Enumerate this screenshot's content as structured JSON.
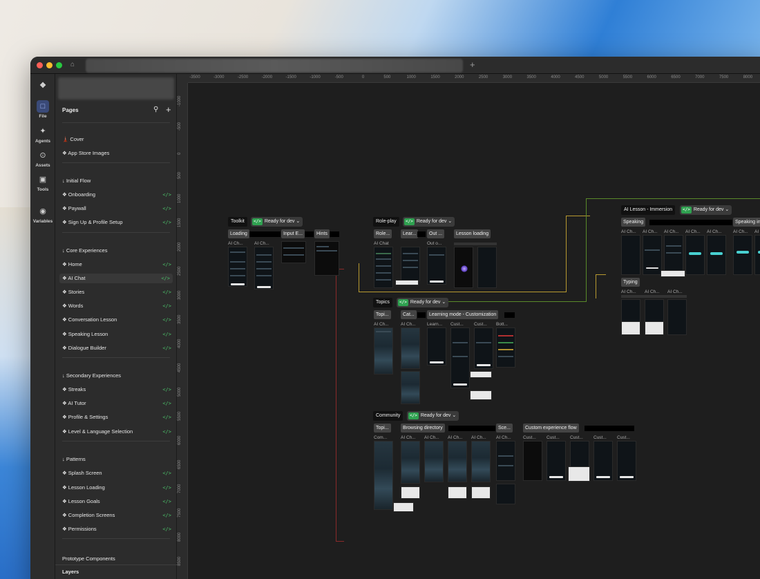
{
  "rail": [
    {
      "name": "file",
      "label": "File"
    },
    {
      "name": "agents",
      "label": "Agents"
    },
    {
      "name": "assets",
      "label": "Assets"
    },
    {
      "name": "tools",
      "label": "Tools"
    },
    {
      "name": "variables",
      "label": "Variables"
    }
  ],
  "pages": {
    "title": "Pages",
    "items": [
      {
        "label": "🗼 Cover",
        "dev": false
      },
      {
        "label": "❖ App Store Images",
        "dev": false
      },
      {
        "label": "↓ Initial Flow",
        "dev": false
      },
      {
        "label": "❖ Onboarding",
        "dev": true
      },
      {
        "label": "❖ Paywall",
        "dev": true
      },
      {
        "label": "❖ Sign Up & Profile Setup",
        "dev": true
      },
      {
        "label": "↓ Core Experiences",
        "dev": false
      },
      {
        "label": "❖ Home",
        "dev": true
      },
      {
        "label": "❖ AI Chat",
        "dev": true
      },
      {
        "label": "❖ Stories",
        "dev": true
      },
      {
        "label": "❖ Words",
        "dev": true
      },
      {
        "label": "❖ Conversation Lesson",
        "dev": true
      },
      {
        "label": "❖ Speaking Lesson",
        "dev": true
      },
      {
        "label": "❖ Dialogue Builder",
        "dev": true
      },
      {
        "label": "↓ Secondary Experiences",
        "dev": false
      },
      {
        "label": "❖ Streaks",
        "dev": true
      },
      {
        "label": "❖ AI Tutor",
        "dev": true
      },
      {
        "label": "❖ Profile & Settings",
        "dev": true
      },
      {
        "label": "❖ Level & Language Selection",
        "dev": true
      },
      {
        "label": "↓ Patterns",
        "dev": false
      },
      {
        "label": "❖ Splash Screen",
        "dev": true
      },
      {
        "label": "❖ Lesson Loading",
        "dev": true
      },
      {
        "label": "❖ Lesson Goals",
        "dev": true
      },
      {
        "label": "❖ Completion Screens",
        "dev": true
      },
      {
        "label": "❖ Permissions",
        "dev": true
      }
    ],
    "prototype_components": "Prototype Components",
    "layers": "Layers",
    "dev_glyph": "</>"
  },
  "ruler": {
    "top": [
      "-3500",
      "-3000",
      "-2500",
      "-2000",
      "-1500",
      "-1000",
      "-500",
      "0",
      "500",
      "1000",
      "1500",
      "2000",
      "2500",
      "3000",
      "3500",
      "4000",
      "4500",
      "5000",
      "5500",
      "6000",
      "6500",
      "7000",
      "7500",
      "8000"
    ],
    "left": [
      "-1000",
      "-500",
      "0",
      "500",
      "1000",
      "1500",
      "2000",
      "2500",
      "3000",
      "3500",
      "4000",
      "4500",
      "5000",
      "5500",
      "6000",
      "6500",
      "7000",
      "7500",
      "8000",
      "8500"
    ]
  },
  "canvas": {
    "ready": "Ready for dev",
    "code": "</>",
    "sections": {
      "toolkit": "Toolkit",
      "roleplay": "Role-play",
      "topics": "Topics",
      "community": "Community",
      "ai_lesson": "AI Lesson - Immersion"
    },
    "chips": {
      "loading": "Loading",
      "input": "Input E...",
      "hints": "Hints",
      "role": "Role...",
      "lear": "Lear...",
      "out": "Out ...",
      "lesson_loading": "Lesson loading",
      "speaking": "Speaking",
      "speaking_ind": "Speaking indication",
      "typing": "Typing",
      "topi": "Topi...",
      "cat": "Cat...",
      "learning_mode": "Learning mode - Customization",
      "topi2": "Topi...",
      "browsing": "Browsing directory",
      "sce": "Sce...",
      "custom_flow": "Custom experience flow"
    },
    "labels": {
      "aich": "AI Ch...",
      "aichat": "AI Chat",
      "outo": "Out o...",
      "learn": "Learn...",
      "cust": "Cust...",
      "bott": "Bott...",
      "com": "Com..."
    }
  }
}
